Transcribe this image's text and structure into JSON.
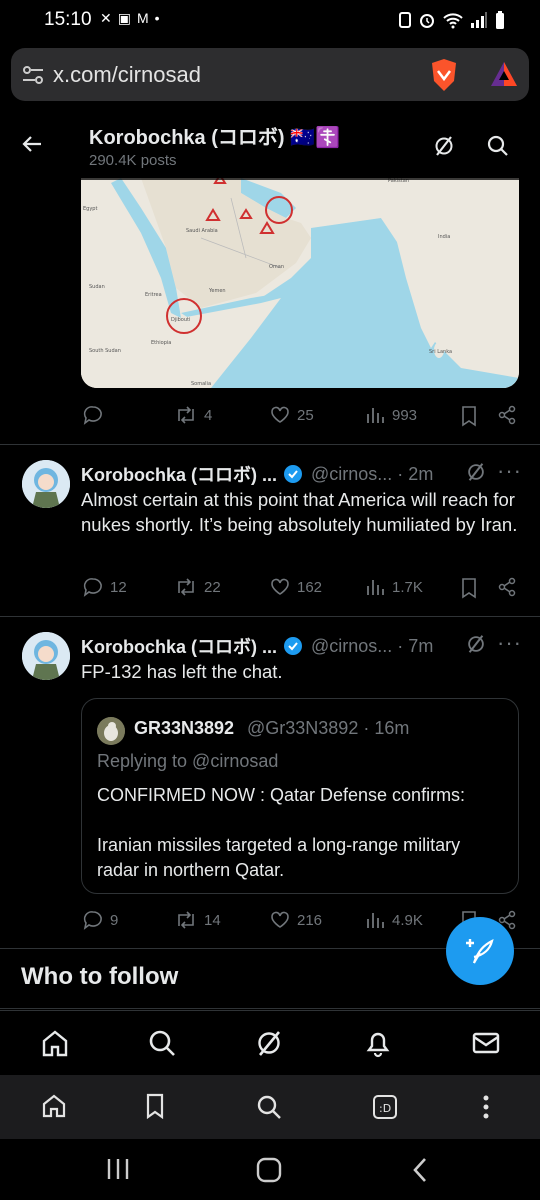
{
  "status_bar": {
    "time": "15:10"
  },
  "browser": {
    "url": "x.com/cirnosad"
  },
  "profile_header": {
    "name": "Korobochka (コロボ) 🇦🇺☦️",
    "posts": "290.4K posts"
  },
  "map": {
    "labels": [
      "Pakistan",
      "Egypt",
      "Saudi Arabia",
      "Oman",
      "Sudan",
      "Eritrea",
      "Yemen",
      "Djibouti",
      "Ethiopia",
      "South Sudan",
      "Somalia",
      "India",
      "Sri Lanka"
    ]
  },
  "tweet0": {
    "reply": "",
    "retweet": "4",
    "like": "25",
    "views": "993"
  },
  "tweet1": {
    "name": "Korobochka (コロボ) ...",
    "handle": "@cirnos... · 2m",
    "text": "Almost certain at this point that America will reach for nukes shortly. It’s being absolutely humiliated by Iran.",
    "reply": "12",
    "retweet": "22",
    "like": "162",
    "views": "1.7K"
  },
  "tweet2": {
    "name": "Korobochka (コロボ) ...",
    "handle": "@cirnos... · 7m",
    "text": "FP-132 has left the chat.",
    "quote": {
      "name": "GR33N3892",
      "handle": "@Gr33N3892 · 16m",
      "replying": "Replying to @cirnosad",
      "text": "CONFIRMED NOW : Qatar Defense confirms:\n\nIranian missiles targeted a long-range military radar in northern Qatar."
    },
    "reply": "9",
    "retweet": "14",
    "like": "216",
    "views": "4.9K"
  },
  "who_to_follow": "Who to follow",
  "colors": {
    "accent": "#1d9bf0",
    "muted": "#71767b",
    "text": "#e7e9ea"
  },
  "icons": [
    "reply-icon",
    "retweet-icon",
    "like-icon",
    "views-icon",
    "bookmark-icon",
    "share-icon",
    "grok-icon",
    "search-icon",
    "home-icon",
    "bell-icon",
    "mail-icon"
  ]
}
